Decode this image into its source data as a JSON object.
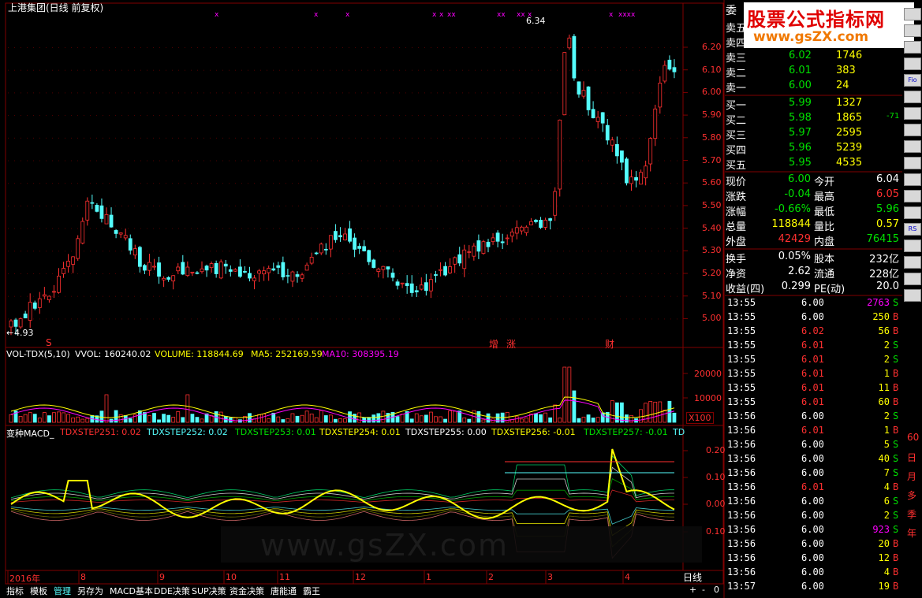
{
  "title": "上港集团(日线 前复权)",
  "watermark": {
    "cn": "股票公式指标网",
    "url": "www.gsZX.com"
  },
  "price_axis": [
    "6.20",
    "6.10",
    "6.00",
    "5.90",
    "5.80",
    "5.70",
    "5.60",
    "5.50",
    "5.40",
    "5.30",
    "5.20",
    "5.10",
    "5.00"
  ],
  "hi_label": "6.34",
  "lo_label": "4.93",
  "markers": [
    "S",
    "增",
    "涨",
    "财"
  ],
  "vol_header": {
    "name": "VOL-TDX(5,10)",
    "vvol": "VVOL: 160240.02",
    "volume": "VOLUME: 118844.69",
    "ma5": "MA5: 252169.59",
    "ma10": "MA10: 308395.19"
  },
  "vol_axis": [
    "20000",
    "10000"
  ],
  "vol_unit": "X100",
  "macd_header": {
    "name": "变种MACD_",
    "s1": "TDXSTEP251: 0.02",
    "s2": "TDXSTEP252: 0.02",
    "s3": "TDXSTEP253: 0.01",
    "s4": "TDXSTEP254: 0.01",
    "s5": "TDXSTEP255: 0.00",
    "s6": "TDXSTEP256: -0.01",
    "s7": "TDXSTEP257: -0.01",
    "s8": "TD"
  },
  "macd_axis": [
    "0.20",
    "0.10",
    "0.00",
    "0.10"
  ],
  "date_axis": [
    "2016年",
    "8",
    "9",
    "10",
    "11",
    "12",
    "1",
    "2",
    "3",
    "4"
  ],
  "period": "日线",
  "bottom_tabs": [
    "指标",
    "模板",
    "管理",
    "另存为",
    "MACD基本",
    "DDE决策",
    "SUP决策",
    "资金决策",
    "唐能通",
    "霸王"
  ],
  "zoom": [
    "+",
    "-",
    "0"
  ],
  "orderbook": {
    "head": "委",
    "sells": [
      {
        "label": "卖五",
        "price": "",
        "vol": ""
      },
      {
        "label": "卖四",
        "price": "",
        "vol": ""
      },
      {
        "label": "卖三",
        "price": "6.02",
        "vol": "1746"
      },
      {
        "label": "卖二",
        "price": "6.01",
        "vol": "383"
      },
      {
        "label": "卖一",
        "price": "6.00",
        "vol": "24"
      }
    ],
    "buys": [
      {
        "label": "买一",
        "price": "5.99",
        "vol": "1327",
        "extra": ""
      },
      {
        "label": "买二",
        "price": "5.98",
        "vol": "1865",
        "extra": "-71"
      },
      {
        "label": "买三",
        "price": "5.97",
        "vol": "2595",
        "extra": ""
      },
      {
        "label": "买四",
        "price": "5.96",
        "vol": "5239",
        "extra": ""
      },
      {
        "label": "买五",
        "price": "5.95",
        "vol": "4535",
        "extra": ""
      }
    ]
  },
  "stats": [
    {
      "l1": "现价",
      "v1": "6.00",
      "l2": "今开",
      "v2": "6.04"
    },
    {
      "l1": "涨跌",
      "v1": "-0.04",
      "l2": "最高",
      "v2": "6.05"
    },
    {
      "l1": "涨幅",
      "v1": "-0.66%",
      "l2": "最低",
      "v2": "5.96"
    },
    {
      "l1": "总量",
      "v1": "118844",
      "l2": "量比",
      "v2": "0.57"
    },
    {
      "l1": "外盘",
      "v1": "42429",
      "l2": "内盘",
      "v2": "76415"
    },
    {
      "l1": "换手",
      "v1": "0.05%",
      "l2": "股本",
      "v2": "232亿"
    },
    {
      "l1": "净资",
      "v1": "2.62",
      "l2": "流通",
      "v2": "228亿"
    },
    {
      "l1": "收益(四)",
      "v1": "0.299",
      "l2": "PE(动)",
      "v2": "20.0"
    }
  ],
  "ticks": [
    {
      "t": "13:55",
      "p": "6.00",
      "v": "2763",
      "d": "S"
    },
    {
      "t": "13:55",
      "p": "6.00",
      "v": "250",
      "d": "B"
    },
    {
      "t": "13:55",
      "p": "6.02",
      "v": "56",
      "d": "B"
    },
    {
      "t": "13:55",
      "p": "6.01",
      "v": "2",
      "d": "S"
    },
    {
      "t": "13:55",
      "p": "6.01",
      "v": "2",
      "d": "S"
    },
    {
      "t": "13:55",
      "p": "6.01",
      "v": "1",
      "d": "B"
    },
    {
      "t": "13:55",
      "p": "6.01",
      "v": "11",
      "d": "B"
    },
    {
      "t": "13:55",
      "p": "6.01",
      "v": "60",
      "d": "B"
    },
    {
      "t": "13:56",
      "p": "6.00",
      "v": "2",
      "d": "S"
    },
    {
      "t": "13:56",
      "p": "6.01",
      "v": "1",
      "d": "B"
    },
    {
      "t": "13:56",
      "p": "6.00",
      "v": "5",
      "d": "S"
    },
    {
      "t": "13:56",
      "p": "6.00",
      "v": "40",
      "d": "S"
    },
    {
      "t": "13:56",
      "p": "6.00",
      "v": "7",
      "d": "S"
    },
    {
      "t": "13:56",
      "p": "6.01",
      "v": "4",
      "d": "B"
    },
    {
      "t": "13:56",
      "p": "6.00",
      "v": "6",
      "d": "S"
    },
    {
      "t": "13:56",
      "p": "6.00",
      "v": "2",
      "d": "S"
    },
    {
      "t": "13:56",
      "p": "6.00",
      "v": "923",
      "d": "S"
    },
    {
      "t": "13:56",
      "p": "6.00",
      "v": "20",
      "d": "B"
    },
    {
      "t": "13:56",
      "p": "6.00",
      "v": "12",
      "d": "B"
    },
    {
      "t": "13:56",
      "p": "6.00",
      "v": "4",
      "d": "B"
    },
    {
      "t": "13:57",
      "p": "6.00",
      "v": "19",
      "d": "B"
    }
  ],
  "side_buttons": [
    "",
    "",
    "",
    "",
    "Fio",
    "",
    "",
    "",
    "",
    "",
    "",
    "",
    "",
    "RS",
    "",
    "",
    "",
    ""
  ],
  "side_labels": [
    "60",
    "日",
    "月",
    "多",
    "季",
    "年"
  ],
  "colors": {
    "up": "#ff3030",
    "down": "#54fcfc",
    "grid": "#800000",
    "yellow": "#ffff00",
    "magenta": "#ff00ff",
    "green": "#00e000"
  }
}
